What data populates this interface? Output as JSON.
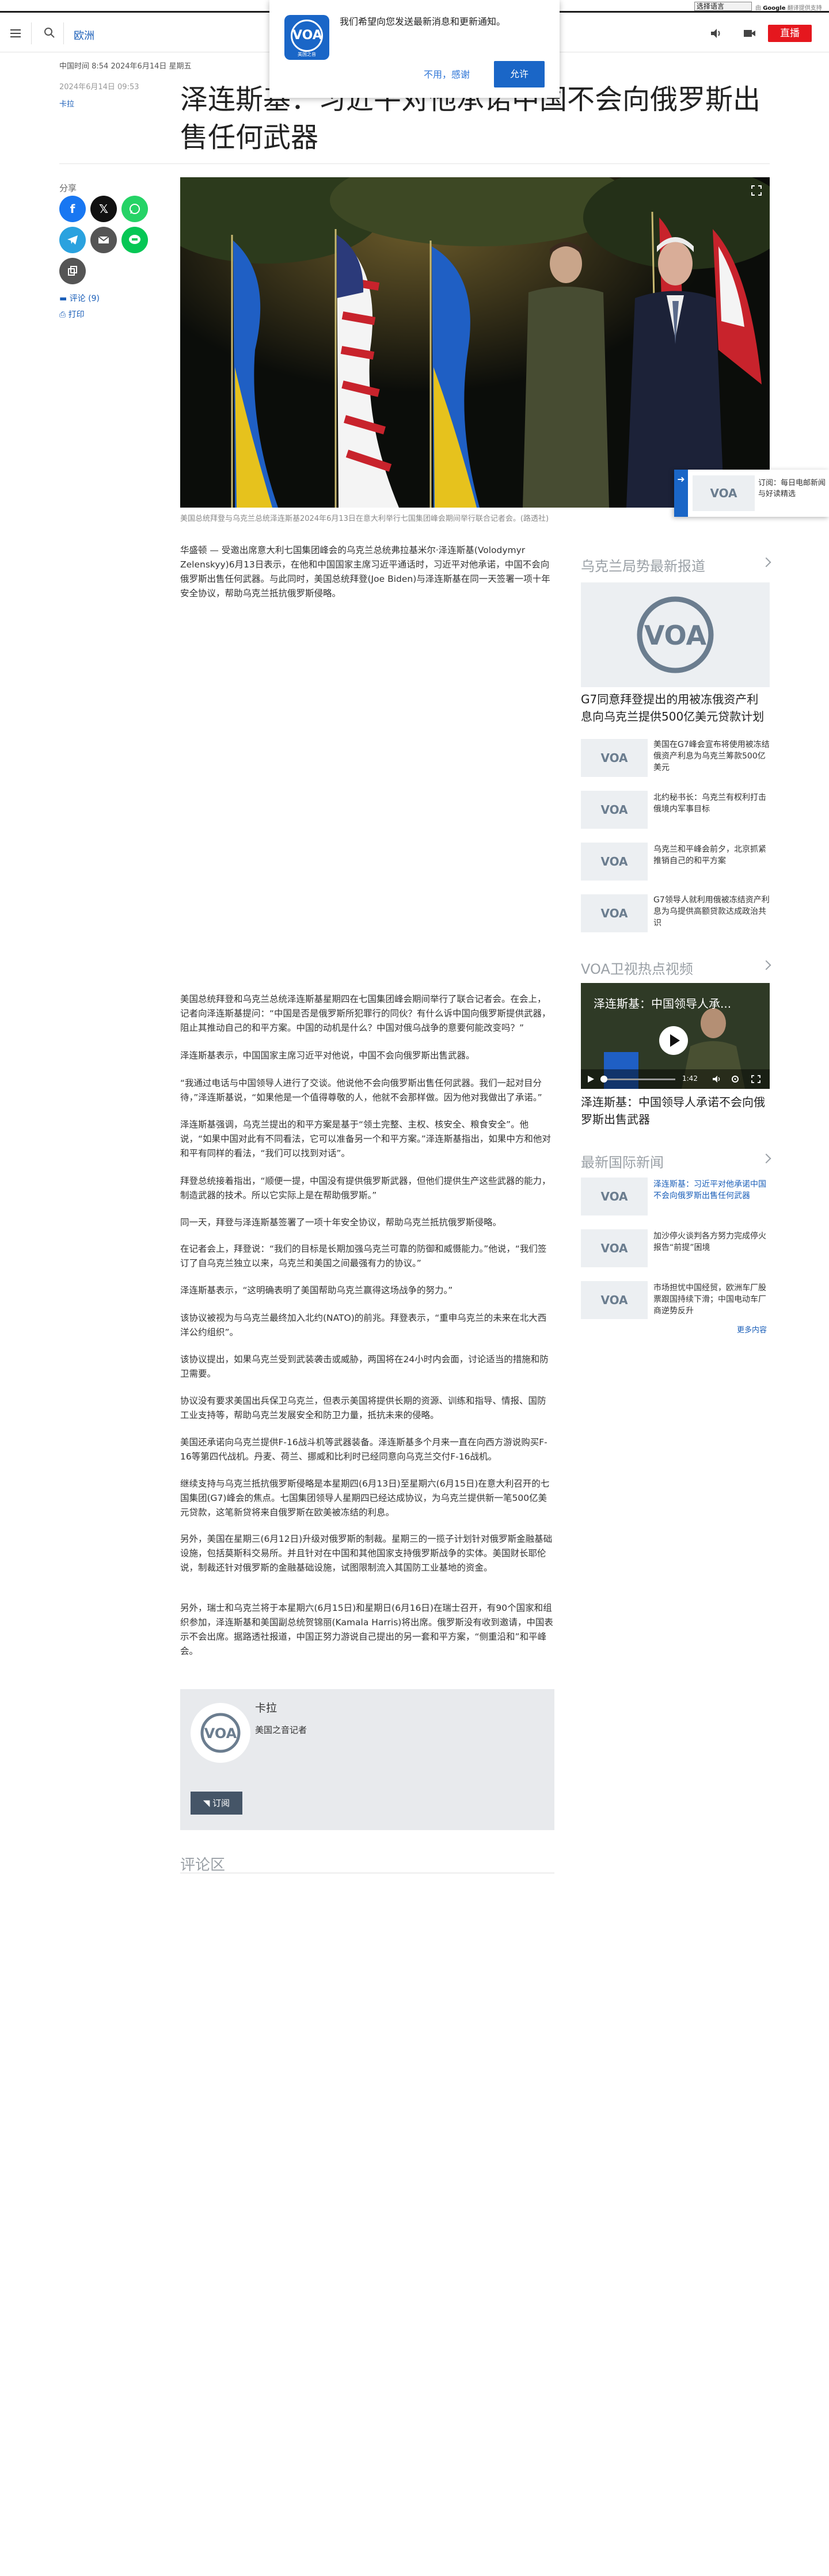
{
  "translate": {
    "select_label": "选择语言",
    "powered_prefix": "由",
    "powered_brand": "Google",
    "powered_suffix": "翻译提供支持"
  },
  "header": {
    "breadcrumb": "欧洲",
    "live_label": "直播"
  },
  "notification": {
    "logo_text": "VOA",
    "logo_subtext": "美国之音",
    "message": "我们希望向您发送最新消息和更新通知。",
    "decline_label": "不用，感谢",
    "accept_label": "允许"
  },
  "article": {
    "time_line_1": "中国时间 8:54 2024年6月14日 星期五",
    "time_line_2": "2024年6月14日 09:53",
    "author": "卡拉",
    "title": "泽连斯基：习近平对他承诺中国不会向俄罗斯出售任何武器",
    "caption": "美国总统拜登与乌克兰总统泽连斯基2024年6月13日在意大利举行七国集团峰会期间举行联合记者会。(路透社)",
    "paragraphs": [
      "华盛顿 — 受邀出席意大利七国集团峰会的乌克兰总统弗拉基米尔·泽连斯基(Volodymyr Zelenskyy)6月13日表示，在他和中国国家主席习近平通话时，习近平对他承诺，中国不会向俄罗斯出售任何武器。与此同时，美国总统拜登(Joe Biden)与泽连斯基在同一天签署一项十年安全协议，帮助乌克兰抵抗俄罗斯侵略。",
      "美国总统拜登和乌克兰总统泽连斯基星期四在七国集团峰会期间举行了联合记者会。在会上，记者向泽连斯基提问：“中国是否是俄罗斯所犯罪行的同伙？有什么诉中国向俄罗斯提供武器，阻止其推动自己的和平方案。中国的动机是什么？中国对俄乌战争的意要何能改变吗？”",
      "泽连斯基表示，中国国家主席习近平对他说，中国不会向俄罗斯出售武器。",
      "“我通过电话与中国领导人进行了交谈。他说他不会向俄罗斯出售任何武器。我们一起对目分待，”泽连斯基说，“如果他是一个值得尊敬的人，他就不会那样做。因为他对我做出了承诺。”",
      "泽连斯基强调，乌克兰提出的和平方案是基于“领土完整、主权、核安全、粮食安全”。他说，“如果中国对此有不同看法，它可以准备另一个和平方案。”泽连斯基指出，如果中方和他对和平有同样的看法，“我们可以找到对话”。",
      "拜登总统接着指出，“顺便一提，中国没有提供俄罗斯武器，但他们提供生产这些武器的能力，制造武器的技术。所以它实际上是在帮助俄罗斯。”",
      "同一天，拜登与泽连斯基签署了一项十年安全协议，帮助乌克兰抵抗俄罗斯侵略。",
      "在记者会上，拜登说：“我们的目标是长期加强乌克兰可靠的防御和威慑能力。”他说，“我们签订了自乌克兰独立以来，乌克兰和美国之间最强有力的协议。”",
      "泽连斯基表示，“这明确表明了美国帮助乌克兰赢得这场战争的努力。”",
      "该协议被视为与乌克兰最终加入北约(NATO)的前兆。拜登表示，“重申乌克兰的未来在北大西洋公约组织”。",
      "该协议提出，如果乌克兰受到武装袭击或威胁，两国将在24小时内会面，讨论适当的措施和防卫需要。",
      "协议没有要求美国出兵保卫乌克兰，但表示美国将提供长期的资源、训练和指导、情报、国防工业支持等，帮助乌克兰发展安全和防卫力量，抵抗未来的侵略。",
      "美国还承诺向乌克兰提供F-16战斗机等武器装备。泽连斯基多个月来一直在向西方游说购买F-16等第四代战机。丹麦、荷兰、挪威和比利时已经同意向乌克兰交付F-16战机。",
      "继续支持与乌克兰抵抗俄罗斯侵略是本星期四(6月13日)至星期六(6月15日)在意大利召开的七国集团(G7)峰会的焦点。七国集团领导人星期四已经达成协议，为乌克兰提供新一笔500亿美元贷款，这笔新贷将来自俄罗斯在欧美被冻结的利息。",
      "另外，美国在星期三(6月12日)升级对俄罗斯的制裁。星期三的一揽子计划针对俄罗斯金融基础设施，包括莫斯科交易所。并且针对在中国和其他国家支持俄罗斯战争的实体。美国财长耶伦说，制裁还针对俄罗斯的金融基础设施，试图限制流入其国防工业基地的资金。",
      "另外，瑞士和乌克兰将于本星期六(6月15日)和星期日(6月16日)在瑞士召开，有90个国家和组织参加，泽连斯基和美国副总统贺锦丽(Kamala Harris)将出席。俄罗斯没有收到邀请，中国表示不会出席。据路透社报道，中国正努力游说自己提出的另一套和平方案，“侧重沿和”和平峰会。"
    ],
    "author_box": {
      "name": "卡拉",
      "role": "美国之音记者",
      "subscribe_label": "订阅"
    },
    "comments_heading": "评论区"
  },
  "share": {
    "label": "分享",
    "comment_link": "评论 (9)",
    "print_link": "打印"
  },
  "sidebar": {
    "ukraine": {
      "heading": "乌克兰局势最新报道",
      "featured_title": "G7同意拜登提出的用被冻俄资产利息向乌克兰提供500亿美元贷款计划",
      "items": [
        "美国在G7峰会宣布将使用被冻结俄资产利息为乌克兰筹款500亿美元",
        "北约秘书长：乌克兰有权利打击俄境内军事目标",
        "乌克兰和平峰会前夕，北京抓紧推销自己的和平方案",
        "G7领导人就利用俄被冻结资产利息为乌提供高额贷款达成政治共识"
      ]
    },
    "video": {
      "heading": "VOA卫视热点视频",
      "overlay_title": "泽连斯基：中国领导人承...",
      "time": "1:42",
      "caption": "泽连斯基：中国领导人承诺不会向俄罗斯出售武器"
    },
    "intl": {
      "heading": "最新国际新闻",
      "items": [
        "泽连斯基：习近平对他承诺中国不会向俄罗斯出售任何武器",
        "加沙停火谈判各方努力完成停火报告“前提”困境",
        "市场担忧中国经贸，欧洲车厂股票跟国持续下滑；中国电动车厂商逆势反升"
      ],
      "more_label": "更多内容"
    }
  },
  "sticky": {
    "text": "订阅：每日电邮新闻与好读精选"
  },
  "colors": {
    "brand_blue": "#1a66c7",
    "live_red": "#e5171e",
    "link_blue": "#1a5eb8"
  }
}
